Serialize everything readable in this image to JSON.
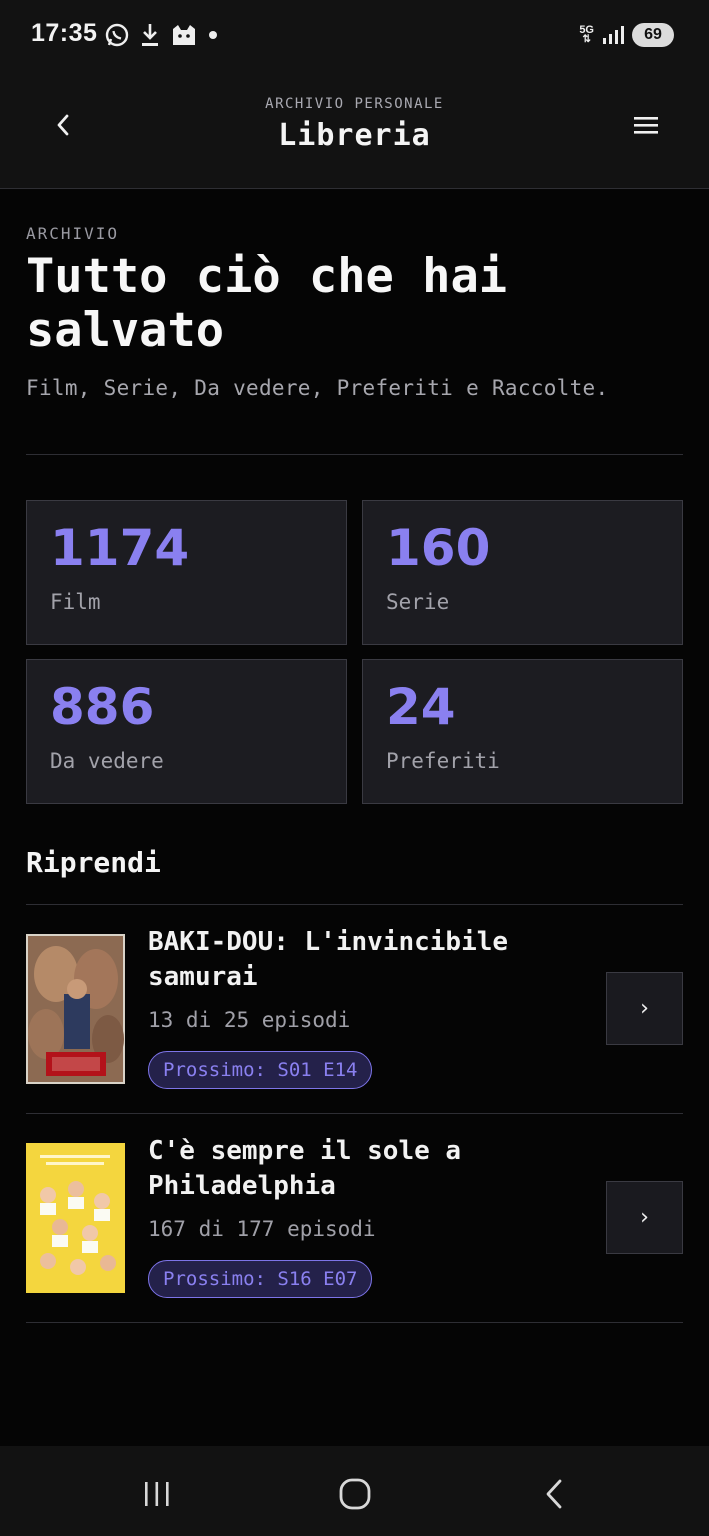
{
  "status_bar": {
    "time": "17:35",
    "network": "5G",
    "battery": "69",
    "icons": [
      "whatsapp-icon",
      "download-icon",
      "cat-app-icon",
      "dot-icon",
      "signal-icon"
    ]
  },
  "header": {
    "kicker": "ARCHIVIO PERSONALE",
    "title": "Libreria",
    "back_icon": "chevron-left-icon",
    "menu_icon": "hamburger-menu-icon"
  },
  "intro": {
    "kicker": "ARCHIVIO",
    "title": "Tutto ciò che hai salvato",
    "subtitle": "Film, Serie, Da vedere, Preferiti e Raccolte."
  },
  "stats": [
    {
      "value": "1174",
      "label": "Film"
    },
    {
      "value": "160",
      "label": "Serie"
    },
    {
      "value": "886",
      "label": "Da vedere"
    },
    {
      "value": "24",
      "label": "Preferiti"
    }
  ],
  "resume": {
    "title": "Riprendi",
    "items": [
      {
        "title": "BAKI-DOU: L'invincibile samurai",
        "episodes": "13 di 25 episodi",
        "next": "Prossimo: S01 E14",
        "action": "›"
      },
      {
        "title": "C'è sempre il sole a Philadelphia",
        "episodes": "167 di 177 episodi",
        "next": "Prossimo: S16 E07",
        "action": "›"
      }
    ]
  },
  "colors": {
    "accent": "#8a80f0",
    "background": "#050505",
    "card": "#1c1c21"
  }
}
